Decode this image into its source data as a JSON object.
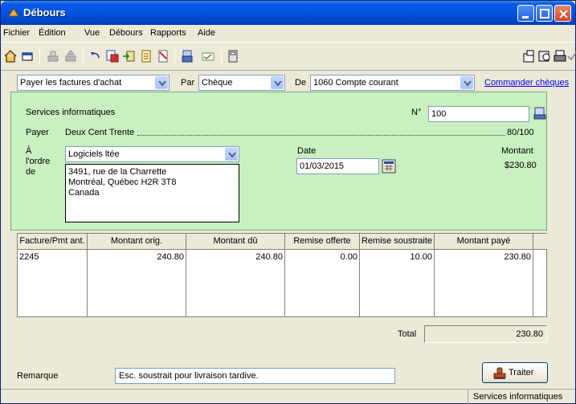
{
  "window": {
    "title": "Débours"
  },
  "menu": [
    "Fichier",
    "Édition",
    "Vue",
    "Débours",
    "Rapports",
    "Aide"
  ],
  "toolbar": {
    "icons": [
      "home-icon",
      "window-icon",
      "print-stack-icon",
      "print-stack-icon",
      "undo-icon",
      "edit-icon",
      "save-icon",
      "report-icon",
      "note-icon",
      "printer-icon",
      "message-icon",
      "calculator-icon",
      "info-icon",
      "preview-icon",
      "print-icon",
      "check-icon"
    ]
  },
  "selector": {
    "type_value": "Payer les factures d'achat",
    "by_label": "Par",
    "method_value": "Chèque",
    "from_label": "De",
    "account_value": "1060 Compte courant",
    "order_checks_link": "Commander chèques"
  },
  "cheque": {
    "payee_header": "Services informatiques",
    "number_label": "N°",
    "number_value": "100",
    "pay_label": "Payer",
    "amount_words": "Deux Cent Trente",
    "amount_fraction": "80/100",
    "to_order_of_label": [
      "À",
      "l'ordre",
      "de"
    ],
    "vendor_value": "Logiciels ltée",
    "address_lines": [
      "3491, rue de la Charrette",
      "Montréal, Québec H2R 3T8",
      "Canada"
    ],
    "date_label": "Date",
    "date_value": "01/03/2015",
    "amount_label": "Montant",
    "amount_value": "$230.80"
  },
  "table": {
    "headers": [
      "Facture/Pmt ant.",
      "Montant orig.",
      "Montant dû",
      "Remise offerte",
      "Remise soustraite",
      "Montant payé"
    ],
    "rows": [
      [
        "2245",
        "240.80",
        "240.80",
        "0.00",
        "10.00",
        "230.80"
      ]
    ]
  },
  "total": {
    "label": "Total",
    "value": "230.80"
  },
  "remark": {
    "label": "Remarque",
    "value": "Esc. soustrait pour livraison tardive."
  },
  "process_button": {
    "label": "Traiter"
  },
  "status": {
    "company": "Services informatiques"
  },
  "colors": {
    "panel_green": "#c8f0c0",
    "titlebar_blue": "#0053e1",
    "link_blue": "#0000ee"
  }
}
